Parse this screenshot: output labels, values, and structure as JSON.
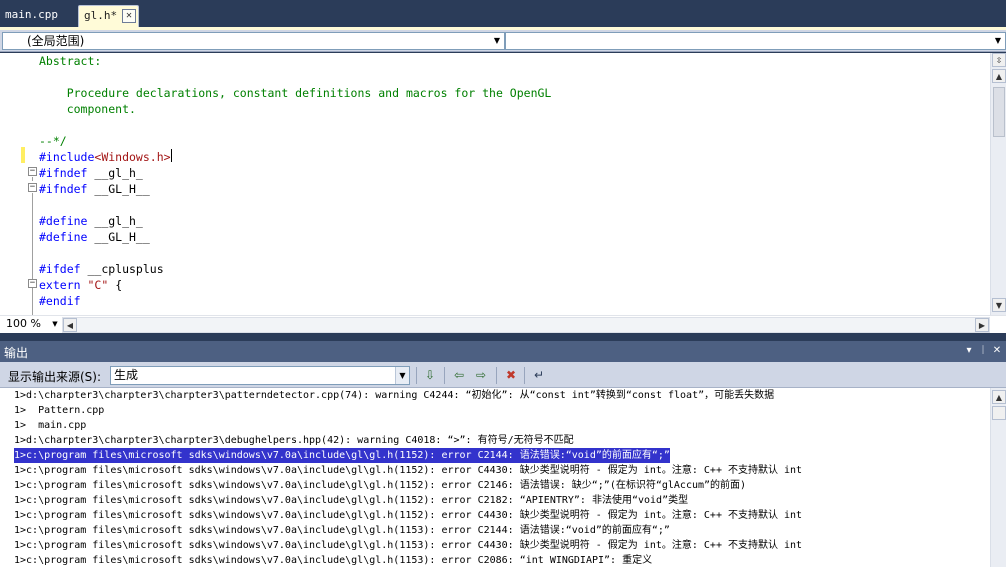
{
  "tabs": [
    {
      "label": "main.cpp",
      "active": false
    },
    {
      "label": "gl.h*",
      "active": true
    }
  ],
  "tab_close_glyph": "✕",
  "navigation": {
    "scope_value": "(全局范围)",
    "member_value": ""
  },
  "code_lines": [
    {
      "text": "Abstract:",
      "color": "comment"
    },
    {
      "text": "",
      "color": "plain"
    },
    {
      "text": "    Procedure declarations, constant definitions and macros for the OpenGL",
      "color": "comment"
    },
    {
      "text": "    component.",
      "color": "comment"
    },
    {
      "text": "",
      "color": "plain"
    },
    {
      "text": "--*/",
      "color": "comment"
    },
    {
      "text": "#include<Windows.h>",
      "color": "mixed-include"
    },
    {
      "text": "#ifndef __gl_h_",
      "color": "mixed-directive"
    },
    {
      "text": "#ifndef __GL_H__",
      "color": "mixed-directive"
    },
    {
      "text": "",
      "color": "plain"
    },
    {
      "text": "#define __gl_h_",
      "color": "mixed-directive"
    },
    {
      "text": "#define __GL_H__",
      "color": "mixed-directive"
    },
    {
      "text": "",
      "color": "plain"
    },
    {
      "text": "#ifdef __cplusplus",
      "color": "mixed-directive"
    },
    {
      "text": "extern \"C\" {",
      "color": "mixed-extern"
    },
    {
      "text": "#endif",
      "color": "keyword"
    }
  ],
  "code_tokens": {
    "include_kw": "#include",
    "include_target": "<Windows.h>",
    "ifndef_kw": "#ifndef",
    "define_kw": "#define",
    "ifdef_kw": "#ifdef",
    "extern_kw": "extern",
    "extern_str": "\"C\"",
    "extern_rest": " {",
    "endif_kw": "#endif",
    "gl_h_lower": " __gl_h_",
    "gl_h_upper": " __GL_H__",
    "cplusplus": " __cplusplus"
  },
  "editor": {
    "zoom_value": "100 %"
  },
  "output_panel": {
    "title": "输出",
    "pin_glyph": "▾ ᛁ ✕",
    "source_label": "显示输出来源(S):",
    "source_value": "生成",
    "lines": [
      "1>d:\\charpter3\\charpter3\\charpter3\\patterndetector.cpp(74): warning C4244: “初始化”: 从“const int”转换到“const float”，可能丢失数据",
      "1>  Pattern.cpp",
      "1>  main.cpp",
      "1>d:\\charpter3\\charpter3\\charpter3\\debughelpers.hpp(42): warning C4018: “>”: 有符号/无符号不匹配",
      "1>c:\\program files\\microsoft sdks\\windows\\v7.0a\\include\\gl\\gl.h(1152): error C2144: 语法错误:“void”的前面应有“;”",
      "1>c:\\program files\\microsoft sdks\\windows\\v7.0a\\include\\gl\\gl.h(1152): error C4430: 缺少类型说明符 - 假定为 int。注意: C++ 不支持默认 int",
      "1>c:\\program files\\microsoft sdks\\windows\\v7.0a\\include\\gl\\gl.h(1152): error C2146: 语法错误: 缺少“;”(在标识符“glAccum”的前面)",
      "1>c:\\program files\\microsoft sdks\\windows\\v7.0a\\include\\gl\\gl.h(1152): error C2182: “APIENTRY”: 非法使用“void”类型",
      "1>c:\\program files\\microsoft sdks\\windows\\v7.0a\\include\\gl\\gl.h(1152): error C4430: 缺少类型说明符 - 假定为 int。注意: C++ 不支持默认 int",
      "1>c:\\program files\\microsoft sdks\\windows\\v7.0a\\include\\gl\\gl.h(1153): error C2144: 语法错误:“void”的前面应有“;”",
      "1>c:\\program files\\microsoft sdks\\windows\\v7.0a\\include\\gl\\gl.h(1153): error C4430: 缺少类型说明符 - 假定为 int。注意: C++ 不支持默认 int",
      "1>c:\\program files\\microsoft sdks\\windows\\v7.0a\\include\\gl\\gl.h(1153): error C2086: “int WINGDIAPI”: 重定义"
    ],
    "selected_line_index": 4
  },
  "colors": {
    "chrome_dark": "#2b3c59",
    "titlebar": "#4d6082",
    "selection": "#3333cc",
    "comment": "#008000",
    "keyword": "#0000ff",
    "string": "#a31515"
  },
  "icons": {
    "dropdown": "chevron-down-icon",
    "toolbar": [
      "go-to-line-icon",
      "prev-message-icon",
      "next-message-icon",
      "clear-all-icon",
      "word-wrap-icon"
    ]
  }
}
